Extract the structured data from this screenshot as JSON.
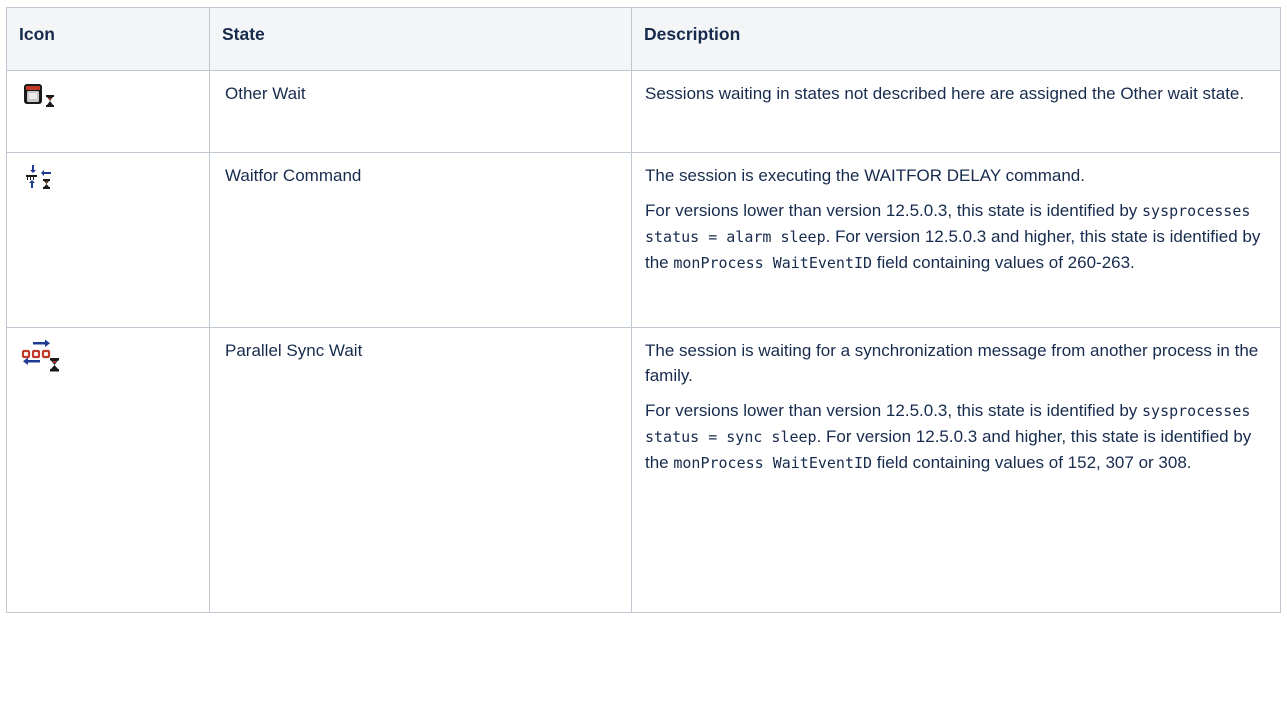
{
  "table": {
    "headers": {
      "icon": "Icon",
      "state": "State",
      "description": "Description"
    },
    "rows": [
      {
        "icon": "other-wait-icon",
        "state": "Other Wait",
        "paragraphs": [
          [
            {
              "t": "Sessions waiting in states not described here are assigned the Other wait state."
            }
          ]
        ]
      },
      {
        "icon": "waitfor-command-icon",
        "state": "Waitfor Command",
        "paragraphs": [
          [
            {
              "t": "The session is executing the WAITFOR DELAY command."
            }
          ],
          [
            {
              "t": "For versions lower than version 12.5.0.3, this state is identified by "
            },
            {
              "c": "sysprocesses status = alarm sleep"
            },
            {
              "t": ". For version 12.5.0.3 and higher, this state is identified by the "
            },
            {
              "c": "monProcess WaitEventID"
            },
            {
              "t": " field containing values of 260-263."
            }
          ]
        ]
      },
      {
        "icon": "parallel-sync-wait-icon",
        "state": "Parallel Sync Wait",
        "paragraphs": [
          [
            {
              "t": "The session is waiting for a synchronization message from another process in the family."
            }
          ],
          [
            {
              "t": "For versions lower than version 12.5.0.3, this state is identified by "
            },
            {
              "c": "sysprocesses status = sync sleep"
            },
            {
              "t": ". For version 12.5.0.3 and higher, this state is identified by the "
            },
            {
              "c": "monProcess WaitEventID"
            },
            {
              "t": " field containing values of 152, 307 or 308."
            }
          ]
        ]
      }
    ]
  }
}
